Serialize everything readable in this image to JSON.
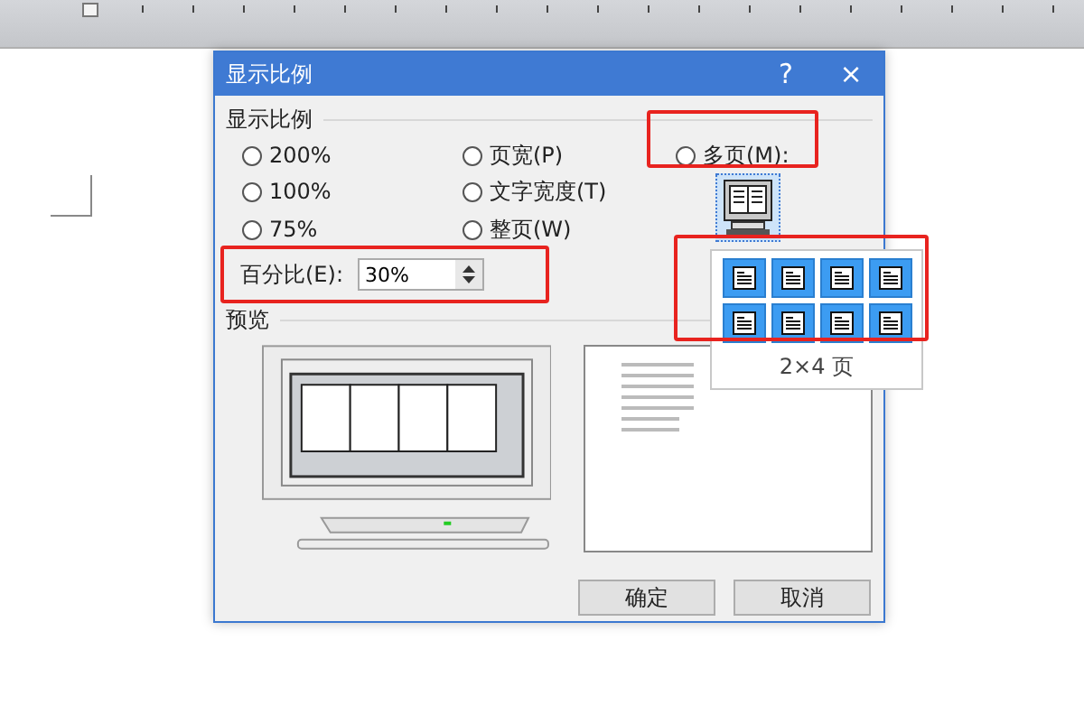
{
  "window": {
    "title": "显示比例",
    "help": "?",
    "close": "×"
  },
  "zoom_group": {
    "title": "显示比例"
  },
  "options": [
    {
      "label": "200%",
      "selected": false
    },
    {
      "label": "页宽(P)",
      "selected": false
    },
    {
      "label": "多页(M):",
      "selected": false
    },
    {
      "label": "100%",
      "selected": false
    },
    {
      "label": "文字宽度(T)",
      "selected": false
    },
    {
      "label": "75%",
      "selected": false
    },
    {
      "label": "整页(W)",
      "selected": false
    }
  ],
  "percent": {
    "label": "百分比(E):",
    "value": "30%"
  },
  "page_picker": {
    "tiles": [
      {
        "selected": true
      },
      {
        "selected": true
      },
      {
        "selected": true
      },
      {
        "selected": true
      },
      {
        "selected": true
      },
      {
        "selected": true
      },
      {
        "selected": true
      },
      {
        "selected": true
      }
    ],
    "caption": "2×4 页"
  },
  "preview": {
    "title": "预览"
  },
  "buttons": [
    "确定",
    "取消"
  ]
}
